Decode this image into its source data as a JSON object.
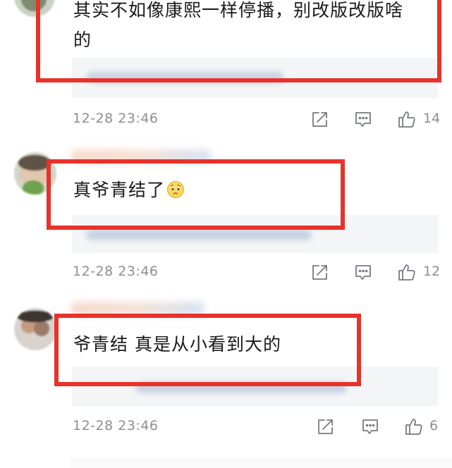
{
  "comments": [
    {
      "text_line1": "其实不如像康熙一样停播，别改版改版啥",
      "text_line2": "的",
      "time": "12-28 23:46",
      "likes": "14"
    },
    {
      "text": "真爷青结了",
      "emoji": "pleading-face-emoji",
      "time": "12-28 23:46",
      "likes": "12"
    },
    {
      "text": "爷青结 真是从小看到大的",
      "time": "12-28 23:46",
      "likes": "6"
    }
  ],
  "icons": {
    "share": "share-icon",
    "comment": "comment-icon",
    "like": "thumbs-up-icon"
  },
  "colors": {
    "highlight_box": "#e8322a",
    "reply_background": "#f4f5f7",
    "meta_text": "#8d8f94"
  }
}
